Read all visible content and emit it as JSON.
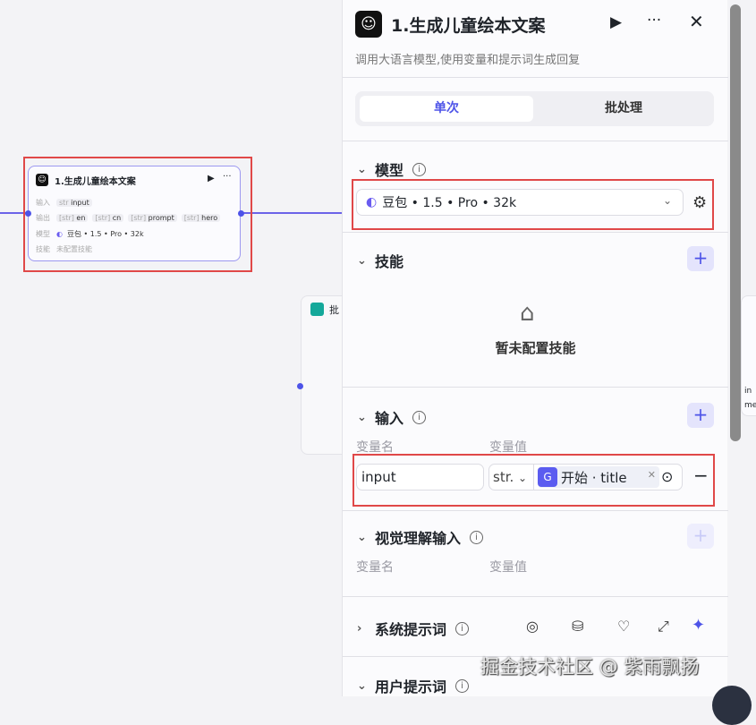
{
  "node": {
    "title": "1.生成儿童绘本文案",
    "input_label": "输入",
    "input_type": "str",
    "input_value": "input",
    "output_label": "输出",
    "outputs": [
      "en",
      "cn",
      "prompt",
      "hero"
    ],
    "output_type": "[str]",
    "model_label": "模型",
    "model_value": "豆包 • 1.5 • Pro • 32k",
    "skill_label": "技能",
    "skill_value": "未配置技能"
  },
  "batch_node": {
    "title_fragment": "批"
  },
  "right_node": {
    "frag1": "in",
    "frag2": "me"
  },
  "panel": {
    "title": "1.生成儿童绘本文案",
    "description": "调用大语言模型,使用变量和提示词生成回复",
    "tabs": [
      {
        "label": "单次",
        "active": true
      },
      {
        "label": "批处理",
        "active": false
      }
    ],
    "model": {
      "label": "模型",
      "value": "豆包 • 1.5 • Pro • 32k"
    },
    "skills": {
      "label": "技能",
      "empty": "暂未配置技能"
    },
    "inputs": {
      "label": "输入",
      "col_name": "变量名",
      "col_value": "变量值",
      "row": {
        "name": "input",
        "type": "str.",
        "ref": "开始 · title"
      }
    },
    "vision": {
      "label": "视觉理解输入",
      "col_name": "变量名",
      "col_value": "变量值"
    },
    "system_prompt": {
      "label": "系统提示词"
    },
    "user_prompt": {
      "label": "用户提示词"
    }
  },
  "watermark": "掘金技术社区 @ 紫雨飘扬",
  "colors": {
    "accent": "#4d53e8",
    "highlight": "#e04848"
  }
}
